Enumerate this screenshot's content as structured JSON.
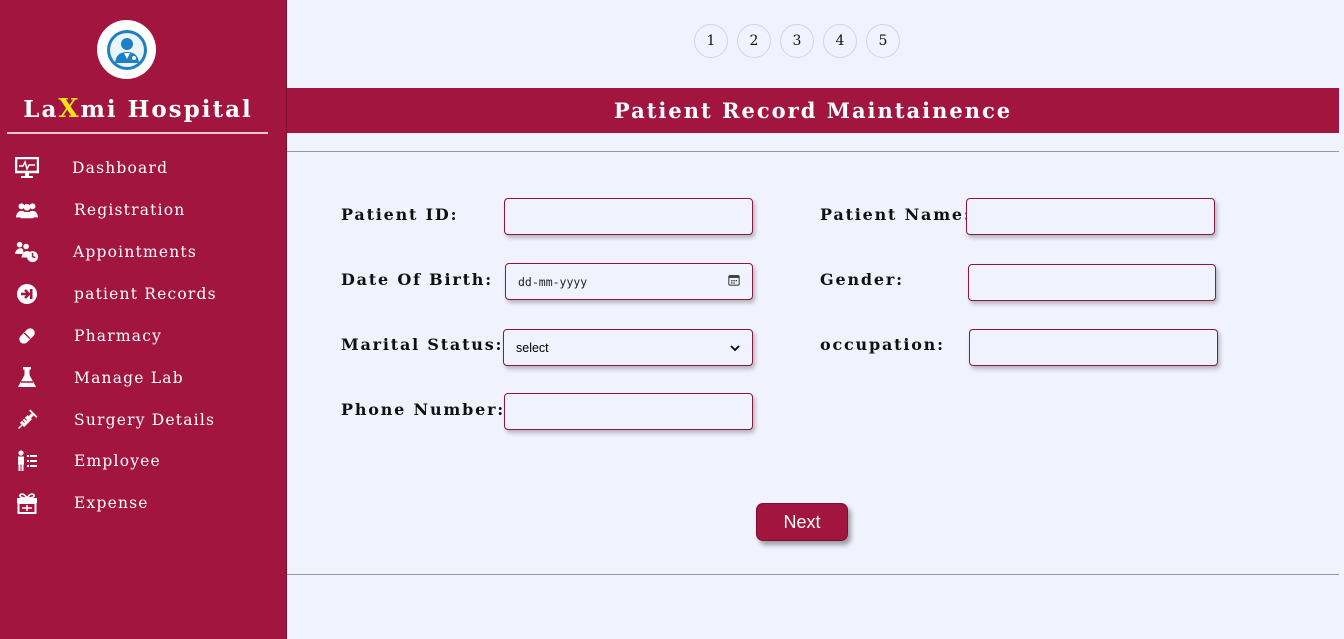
{
  "sidebar": {
    "brand_prefix": "La",
    "brand_highlight": "X",
    "brand_suffix": "mi Hospital",
    "items": [
      {
        "label": "Dashboard",
        "icon": "monitor-icon"
      },
      {
        "label": "Registration",
        "icon": "users-icon"
      },
      {
        "label": "Appointments",
        "icon": "appointment-clock-icon"
      },
      {
        "label": "patient Records",
        "icon": "record-icon"
      },
      {
        "label": "Pharmacy",
        "icon": "pill-icon"
      },
      {
        "label": "Manage Lab",
        "icon": "flask-icon"
      },
      {
        "label": "Surgery Details",
        "icon": "syringe-icon"
      },
      {
        "label": "Employee",
        "icon": "employee-list-icon"
      },
      {
        "label": "Expense",
        "icon": "gift-box-icon"
      }
    ]
  },
  "pager": [
    "1",
    "2",
    "3",
    "4",
    "5"
  ],
  "header": {
    "title": "Patient Record Maintainence"
  },
  "form": {
    "patient_id_label": "Patient ID:",
    "patient_name_label": "Patient Name:",
    "dob_label": "Date Of Birth:",
    "dob_placeholder": "dd-mm-yyyy",
    "gender_label": "Gender:",
    "marital_label": "Marital Status:",
    "marital_value": "select",
    "occupation_label": "occupation:",
    "phone_label": "Phone Number:",
    "next_label": "Next"
  },
  "colors": {
    "accent": "#a2153e",
    "highlight": "#ffe11a",
    "background": "#f0f2fd"
  }
}
